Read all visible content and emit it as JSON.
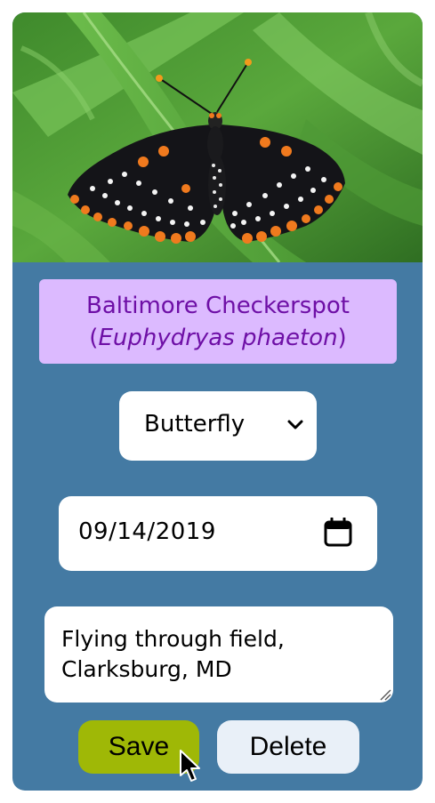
{
  "species": {
    "common_name": "Baltimore Checkerspot",
    "paren_open": "(",
    "scientific_name": "Euphydryas phaeton",
    "paren_close": ")"
  },
  "category_select": {
    "selected": "Butterfly"
  },
  "date_input": {
    "value": "09/14/2019"
  },
  "notes_field": {
    "value": "Flying through field,\nClarksburg, MD"
  },
  "buttons": {
    "save_label": "Save",
    "delete_label": "Delete"
  },
  "colors": {
    "card_background": "#447aa3",
    "title_background": "#dcbaff",
    "title_text": "#6e0fa6",
    "save_button": "#9fb806",
    "delete_button": "#e9f0f8"
  },
  "icons": {
    "select_arrow": "chevron-down-icon",
    "date_picker": "calendar-icon",
    "resize": "resize-grip-icon",
    "pointer": "mouse-cursor-icon"
  }
}
